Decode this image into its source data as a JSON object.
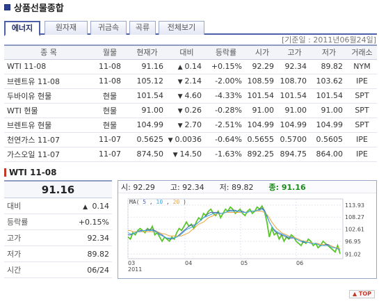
{
  "page": {
    "title": "상품선물종합"
  },
  "tabs": [
    {
      "label": "에너지",
      "active": true
    },
    {
      "label": "원자재",
      "active": false
    },
    {
      "label": "귀금속",
      "active": false
    },
    {
      "label": "곡류",
      "active": false
    },
    {
      "label": "전체보기",
      "active": false
    }
  ],
  "base_date": "[기준일 : 2011년06월24일]",
  "table": {
    "headers": [
      "종 목",
      "월물",
      "현재가",
      "대비",
      "등락률",
      "시가",
      "고가",
      "저가",
      "거래소"
    ],
    "rows": [
      {
        "name": "WTI 11-08",
        "month": "11-08",
        "price": "91.16",
        "dir": "up",
        "change": "0.14",
        "rate": "+0.15%",
        "open": "92.29",
        "high": "92.34",
        "low": "89.82",
        "exchange": "NYM"
      },
      {
        "name": "브렌트유 11-08",
        "month": "11-08",
        "price": "105.12",
        "dir": "down",
        "change": "2.14",
        "rate": "-2.00%",
        "open": "108.59",
        "high": "108.70",
        "low": "103.62",
        "exchange": "IPE"
      },
      {
        "name": "두바이유 현물",
        "month": "현물",
        "price": "101.54",
        "dir": "down",
        "change": "4.60",
        "rate": "-4.33%",
        "open": "101.54",
        "high": "101.54",
        "low": "101.54",
        "exchange": "SPT"
      },
      {
        "name": "WTI 현물",
        "month": "현물",
        "price": "91.00",
        "dir": "down",
        "change": "0.26",
        "rate": "-0.28%",
        "open": "91.00",
        "high": "91.00",
        "low": "91.00",
        "exchange": "SPT"
      },
      {
        "name": "브렌트유 현물",
        "month": "현물",
        "price": "104.99",
        "dir": "down",
        "change": "2.70",
        "rate": "-2.51%",
        "open": "104.99",
        "high": "104.99",
        "low": "104.99",
        "exchange": "SPT"
      },
      {
        "name": "천연가스 11-07",
        "month": "11-07",
        "price": "0.5625",
        "dir": "down",
        "change": "0.0036",
        "rate": "-0.64%",
        "open": "0.5655",
        "high": "0.5700",
        "low": "0.5605",
        "exchange": "IPE"
      },
      {
        "name": "가스오일 11-07",
        "month": "11-07",
        "price": "874.50",
        "dir": "down",
        "change": "14.50",
        "rate": "-1.63%",
        "open": "892.25",
        "high": "894.75",
        "low": "864.00",
        "exchange": "IPE"
      }
    ]
  },
  "detail": {
    "title": "WTI 11-08",
    "price": "91.16",
    "rows": [
      {
        "label": "대비",
        "value": "0.14",
        "dir": "up"
      },
      {
        "label": "등락률",
        "value": "+0.15%",
        "dir": "up"
      },
      {
        "label": "고가",
        "value": "92.34",
        "dir": ""
      },
      {
        "label": "저가",
        "value": "89.82",
        "dir": ""
      },
      {
        "label": "시간",
        "value": "06/24",
        "dir": ""
      }
    ]
  },
  "chart_header": {
    "open": "시: 92.29",
    "high": "고: 92.34",
    "low": "저: 89.82",
    "close": "종: 91.16"
  },
  "chart_data": {
    "type": "line",
    "legend_prefix": "MA(",
    "legend_periods": [
      "5",
      "10",
      "20"
    ],
    "legend_suffix": ")",
    "x_ticks": [
      "03",
      "04",
      "05",
      "06"
    ],
    "x_year": "2011",
    "y_ticks": [
      "113.93",
      "108.27",
      "102.61",
      "96.95",
      "91.02"
    ],
    "ylim": [
      89.5,
      115.5
    ],
    "series": [
      {
        "color": "#59c729",
        "values": [
          99,
          98,
          101,
          100,
          102,
          103,
          102,
          101,
          103,
          102,
          104,
          100,
          101,
          99,
          97,
          99,
          98,
          97,
          99,
          98,
          101,
          103,
          102,
          104,
          106,
          104,
          105,
          103,
          106,
          108,
          107,
          110,
          109,
          111,
          112,
          110,
          109,
          111,
          108,
          110,
          112,
          111,
          113,
          112,
          110,
          111,
          112,
          110,
          109,
          111,
          112,
          110,
          111,
          113,
          112,
          113.5,
          111,
          106,
          99,
          103,
          100,
          101,
          98,
          100,
          97,
          99,
          98,
          100,
          99,
          97,
          96,
          95,
          97,
          96,
          98,
          97,
          95,
          96,
          94,
          95,
          97,
          96,
          95,
          94,
          93,
          92,
          95,
          91.16
        ]
      },
      {
        "color": "#4a5fa8",
        "values": [
          100,
          100,
          100.5,
          101,
          101.5,
          102,
          102,
          102,
          102.5,
          102.5,
          102.5,
          102,
          101.5,
          100.5,
          100,
          99,
          98.5,
          98,
          98,
          98.5,
          99,
          100,
          101,
          102,
          103,
          104,
          104.5,
          104.5,
          105,
          106,
          107,
          108,
          109,
          110,
          110.5,
          110.5,
          110.5,
          110.5,
          110,
          110,
          110.5,
          111,
          111.5,
          111.5,
          111.5,
          111,
          111,
          111,
          110.5,
          110.5,
          111,
          111,
          111,
          111.5,
          112,
          112.5,
          111.5,
          109,
          106,
          104,
          102,
          101,
          100.5,
          100,
          99.5,
          99,
          98.5,
          98.5,
          98.5,
          98,
          97.5,
          97,
          96.5,
          96.5,
          96.5,
          96.5,
          96,
          96,
          95.5,
          95,
          95,
          95.5,
          95.5,
          95,
          94.5,
          94,
          93.5,
          93
        ]
      },
      {
        "color": "#e8a33c",
        "values": [
          102,
          102,
          101.5,
          101.5,
          101.5,
          101.5,
          101.5,
          101.5,
          101.5,
          101.5,
          101.5,
          101.5,
          101.5,
          101,
          100.5,
          100.5,
          100,
          99.5,
          99.5,
          99.5,
          99.5,
          99.5,
          99.5,
          100,
          100.5,
          101,
          102,
          103,
          104,
          105,
          105.5,
          106,
          107,
          108,
          108.5,
          109,
          109.5,
          110,
          110,
          110,
          110.5,
          110.5,
          110.5,
          110.5,
          110.5,
          110.5,
          110.5,
          110.5,
          110.5,
          110.5,
          111,
          111,
          111,
          111,
          111,
          111,
          110.5,
          109.5,
          108,
          106,
          104.5,
          103,
          102,
          101,
          100.5,
          100,
          99.5,
          99,
          99,
          98.5,
          98,
          97.5,
          97,
          97,
          96.5,
          96.5,
          96,
          96,
          96,
          95.5,
          95.5,
          95,
          95,
          95,
          94.5,
          94,
          94,
          93.5
        ]
      },
      {
        "color": "#3aa7e0",
        "values": [
          101,
          100.5,
          100.5,
          101,
          101.5,
          101.5,
          102,
          102,
          102,
          102,
          102,
          101.5,
          101,
          100,
          99.5,
          99,
          98.5,
          98.5,
          98.5,
          98.5,
          99,
          99.5,
          100.5,
          101.5,
          102.5,
          103,
          103.5,
          104,
          105,
          106,
          107,
          108,
          108.5,
          109,
          109.5,
          110,
          110,
          110,
          110,
          110,
          110.5,
          111,
          111,
          111,
          111,
          111,
          111,
          110.5,
          110.5,
          110.5,
          111,
          111,
          111,
          111.5,
          111.5,
          112,
          111,
          108.5,
          106,
          104,
          102.5,
          101.5,
          101,
          100.5,
          100,
          99.5,
          99,
          99,
          98.5,
          98,
          97.5,
          97,
          97,
          96.5,
          96.5,
          96,
          96,
          96,
          95.5,
          95,
          95,
          95,
          95,
          94.5,
          94,
          94,
          93.5,
          93
        ]
      }
    ]
  },
  "top_button": "▲ TOP"
}
